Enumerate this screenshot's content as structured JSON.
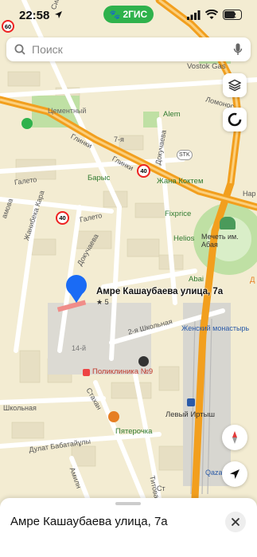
{
  "status_bar": {
    "time": "22:58",
    "brand": "2ГИС",
    "battery": "42",
    "icons": [
      "location-arrow-icon",
      "cellular-signal-icon",
      "wifi-icon",
      "battery-icon"
    ]
  },
  "search": {
    "placeholder": "Поиск",
    "icons": [
      "search-icon",
      "microphone-icon"
    ]
  },
  "controls": {
    "icons": [
      "layers-icon",
      "compass-ring-icon",
      "compass-needle-icon",
      "my-location-icon",
      "close-icon"
    ]
  },
  "map": {
    "streets": {
      "top_right": "Vostok Gas",
      "lomonosov": "Ломонос",
      "cement": "Цементный",
      "alem": "Alem",
      "glinka_1": "Глинки",
      "glinka_2": "Глинки",
      "dokuchaeva_1": "Докучаева",
      "dokuchaeva_2": "Докучаева",
      "num_7a": "7-я",
      "barys": "Барыс",
      "zhana_koktem": "Жана Коктем",
      "stk": "STK",
      "galeto_1": "Галето",
      "galeto_2": "Галето",
      "fixprice": "Fixprice",
      "helios": "Helios",
      "zhanibek": "Жанибека Кара",
      "mosque": "Мечеть им. Абая",
      "abai": "Abai",
      "shkolnaya_2": "2-я Школьная",
      "women_monastery": "Женский монастырь",
      "num_14": "14-й",
      "polyclinic": "Поликлиника №9",
      "shkolnaya": "Школьная",
      "stakh": "Стахан",
      "levy_irtysh": "Левый Иртыш",
      "pyaterochka": "Пятерочка",
      "dulat": "Дулат Бабатайұлы",
      "amiln": "Амилн",
      "titova": "Титова",
      "qazaq": "Qazaq",
      "nar": "Нар",
      "sinitsa": "Синица",
      "amo": "амова",
      "d_right": "Д",
      "st": "Ст"
    },
    "speed_limits": [
      "60",
      "40",
      "40"
    ],
    "icons": [
      "speed-camera-icon",
      "shop-icon",
      "park-icon",
      "mosque-icon",
      "hospital-icon",
      "store-icon",
      "rail-icon"
    ]
  },
  "selected_place": {
    "name": "Амре Кашаубаева улица, 7а",
    "rating": "★ 5"
  },
  "bottom_sheet": {
    "title": "Амре Кашаубаева улица, 7а"
  },
  "colors": {
    "main_road": "#f29f1e",
    "secondary_road": "#ffffff",
    "map_bg": "#f3ecd2",
    "green": "#b8dca0",
    "pin_blue": "#1a6bf5",
    "brand_green": "#2fb24c"
  }
}
